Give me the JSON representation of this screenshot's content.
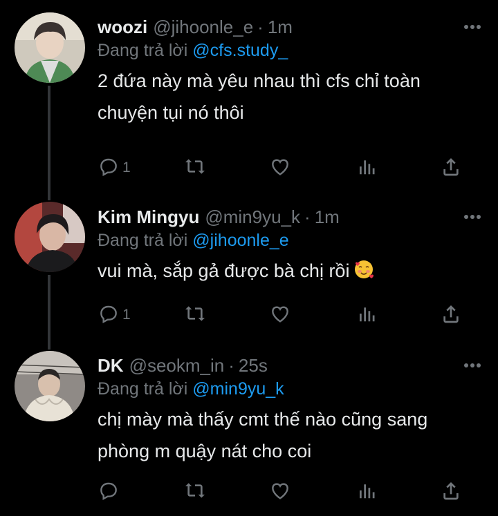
{
  "tweets": [
    {
      "name": "woozi",
      "handle": "@jihoonle_e",
      "time": "1m",
      "replying_label": "Đang trả lời",
      "replying_to": "@cfs.study_",
      "text_lines": [
        "2 đứa này mà yêu nhau thì cfs chỉ toàn",
        "chuyện tụi nó thôi"
      ],
      "reply_count": "1"
    },
    {
      "name": "Kim Mingyu",
      "handle": "@min9yu_k",
      "time": "1m",
      "replying_label": "Đang trả lời",
      "replying_to": "@jihoonle_e",
      "text_lines": [
        "vui mà, sắp gả được bà chị rồi"
      ],
      "emoji": "smiling-face-with-hearts",
      "reply_count": "1"
    },
    {
      "name": "DK",
      "handle": "@seokm_in",
      "time": "25s",
      "replying_label": "Đang trả lời",
      "replying_to": "@min9yu_k",
      "text_lines": [
        "chị mày mà thấy cmt thế nào cũng sang",
        "phòng m quậy nát cho coi"
      ],
      "reply_count": ""
    }
  ],
  "separator": "·",
  "colors": {
    "background": "#000000",
    "text": "#e7e9ea",
    "muted": "#71767b",
    "link": "#1d9bf0",
    "thread": "#333639"
  },
  "icons": [
    "reply-icon",
    "retweet-icon",
    "like-icon",
    "views-icon",
    "share-icon",
    "more-icon"
  ]
}
